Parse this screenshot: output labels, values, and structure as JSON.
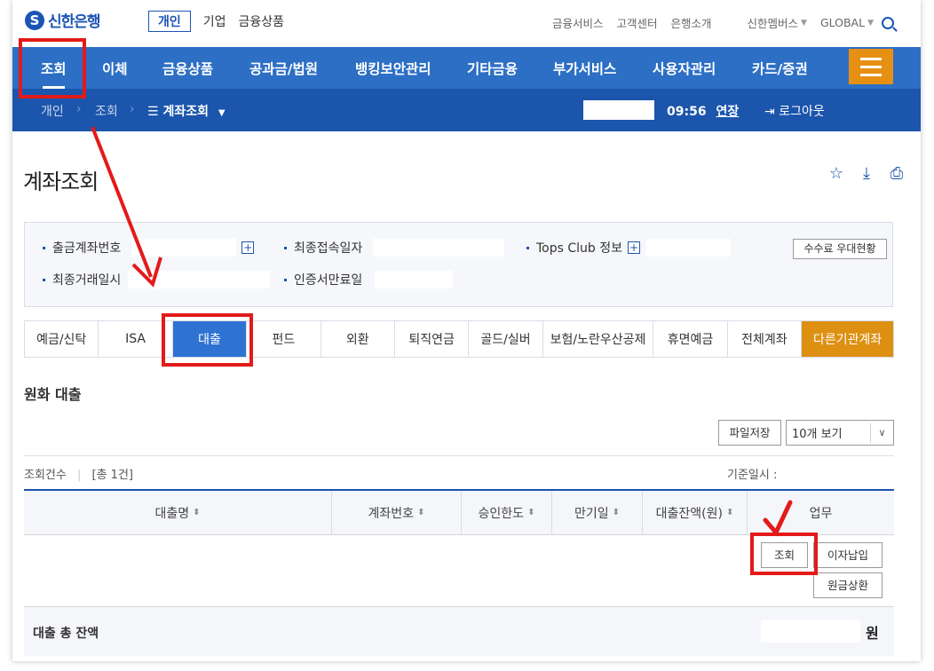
{
  "header": {
    "logo_text": "신한은행",
    "segment_active": "개인",
    "segment_others": [
      "기업",
      "금융상품"
    ],
    "util_links": [
      "금융서비스",
      "고객센터",
      "은행소개"
    ],
    "members": "신한멤버스",
    "global": "GLOBAL"
  },
  "gnb": {
    "items": [
      "조회",
      "이체",
      "금융상품",
      "공과금/법원",
      "뱅킹보안관리",
      "기타금융",
      "부가서비스",
      "사용자관리",
      "카드/증권"
    ]
  },
  "breadcrumb": {
    "items": [
      "개인",
      "조회",
      "계좌조회"
    ],
    "time": "09:56",
    "extend": "연장",
    "logout": "로그아웃"
  },
  "page": {
    "title": "계좌조회"
  },
  "info": {
    "account_label": "출금계좌번호",
    "last_access_label": "최종접속일자",
    "tops_label": "Tops Club 정보",
    "fee_button": "수수료 우대현황",
    "last_tx_label": "최종거래일시",
    "cert_label": "인증서만료일"
  },
  "tabs": [
    "예금/신탁",
    "ISA",
    "대출",
    "펀드",
    "외환",
    "퇴직연금",
    "골드/실버",
    "보험/노란우산공제",
    "휴면예금",
    "전체계좌",
    "다른기관계좌"
  ],
  "section": {
    "title": "원화 대출",
    "file_save": "파일저장",
    "view_select": "10개 보기",
    "count_label": "조회건수",
    "count_value": "[총 1건]",
    "base_date_label": "기준일시 :"
  },
  "table": {
    "headers": [
      "대출명",
      "계좌번호",
      "승인한도",
      "만기일",
      "대출잔액(원)",
      "업무"
    ],
    "actions": {
      "inquiry": "조회",
      "interest": "이자납입",
      "repay": "원금상환"
    }
  },
  "total": {
    "label": "대출 총 잔액",
    "unit": "원"
  },
  "colors": {
    "brand_blue": "#2d6fc4",
    "dark_blue": "#1b55ac",
    "orange": "#e69013",
    "annotation_red": "#e31a1a"
  }
}
